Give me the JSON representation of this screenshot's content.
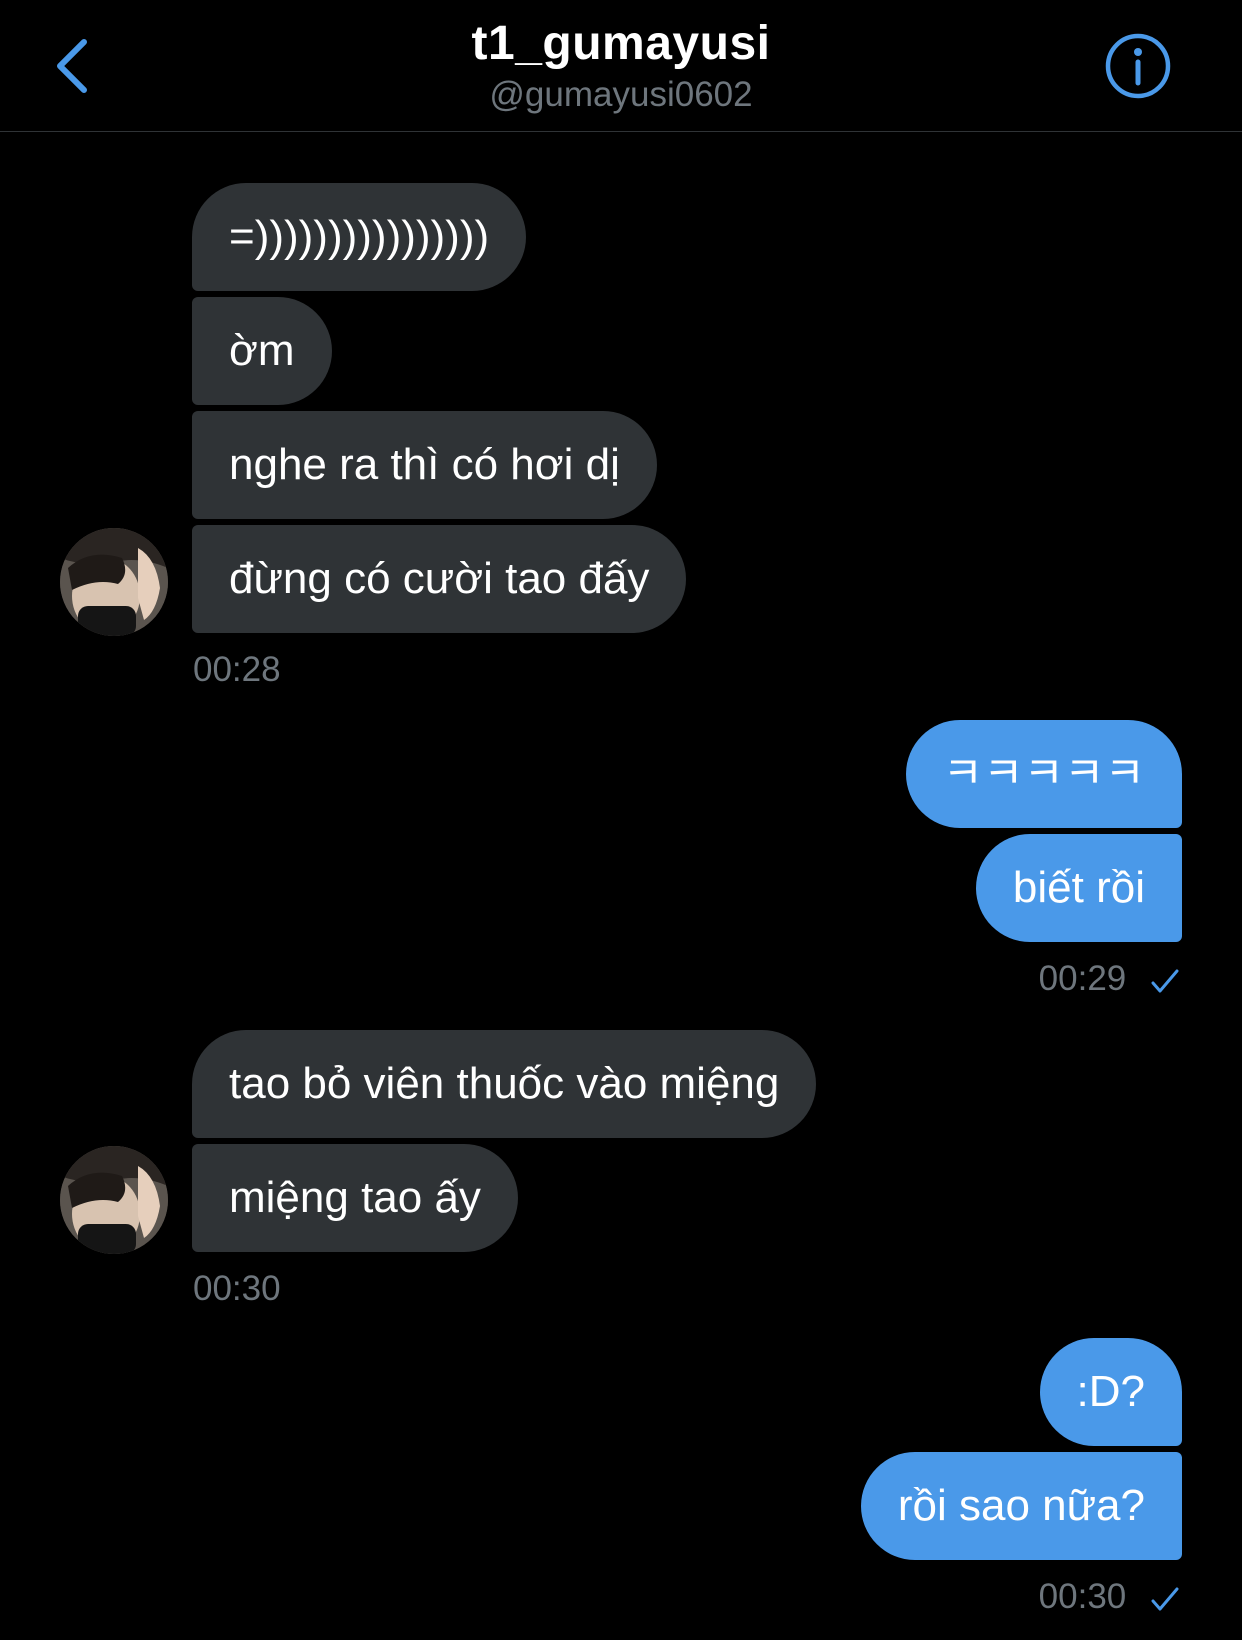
{
  "header": {
    "title": "t1_gumayusi",
    "handle": "@gumayusi0602",
    "back_icon": "chevron-left-icon",
    "info_icon": "info-circle-icon"
  },
  "colors": {
    "accent": "#4a99e9",
    "incoming_bubble": "#2f3336",
    "background": "#000000",
    "meta_text": "#6e767d"
  },
  "messages": {
    "group1": {
      "m1": "=))))))))))))))))",
      "m2": "ờm",
      "m3": "nghe ra thì có hơi dị",
      "m4": "đừng có cười tao đấy",
      "time": "00:28"
    },
    "group2": {
      "m1": "ㅋㅋㅋㅋㅋ",
      "m2": "biết rồi",
      "time": "00:29",
      "status_icon": "sent-check-icon"
    },
    "group3": {
      "m1": "tao bỏ viên thuốc vào miệng",
      "m2": "miệng tao ấy",
      "time": "00:30"
    },
    "group4": {
      "m1": ":D?",
      "m2": "rồi sao nữa?",
      "time": "00:30",
      "status_icon": "sent-check-icon"
    }
  }
}
